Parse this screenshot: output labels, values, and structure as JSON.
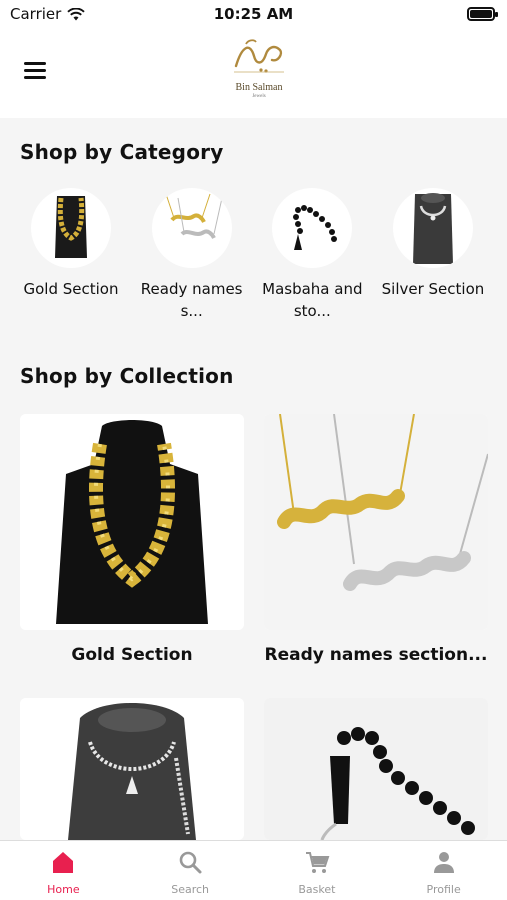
{
  "status_bar": {
    "carrier": "Carrier",
    "time": "10:25 AM"
  },
  "header": {
    "logo_text": "Bin Salman",
    "logo_sub": "Jewels"
  },
  "categories_section": {
    "title": "Shop by Category",
    "items": [
      {
        "label": "Gold Section"
      },
      {
        "label": "Ready names s..."
      },
      {
        "label": "Masbaha and sto..."
      },
      {
        "label": "Silver Section"
      }
    ]
  },
  "collections_section": {
    "title": "Shop by Collection",
    "items": [
      {
        "label": "Gold Section"
      },
      {
        "label": "Ready names section..."
      },
      {
        "label": ""
      },
      {
        "label": ""
      }
    ]
  },
  "tabbar": {
    "items": [
      {
        "label": "Home",
        "icon": "home-icon"
      },
      {
        "label": "Search",
        "icon": "search-icon"
      },
      {
        "label": "Basket",
        "icon": "cart-icon"
      },
      {
        "label": "Profile",
        "icon": "profile-icon"
      }
    ],
    "active_color": "#e8204f",
    "inactive_color": "#999999"
  }
}
